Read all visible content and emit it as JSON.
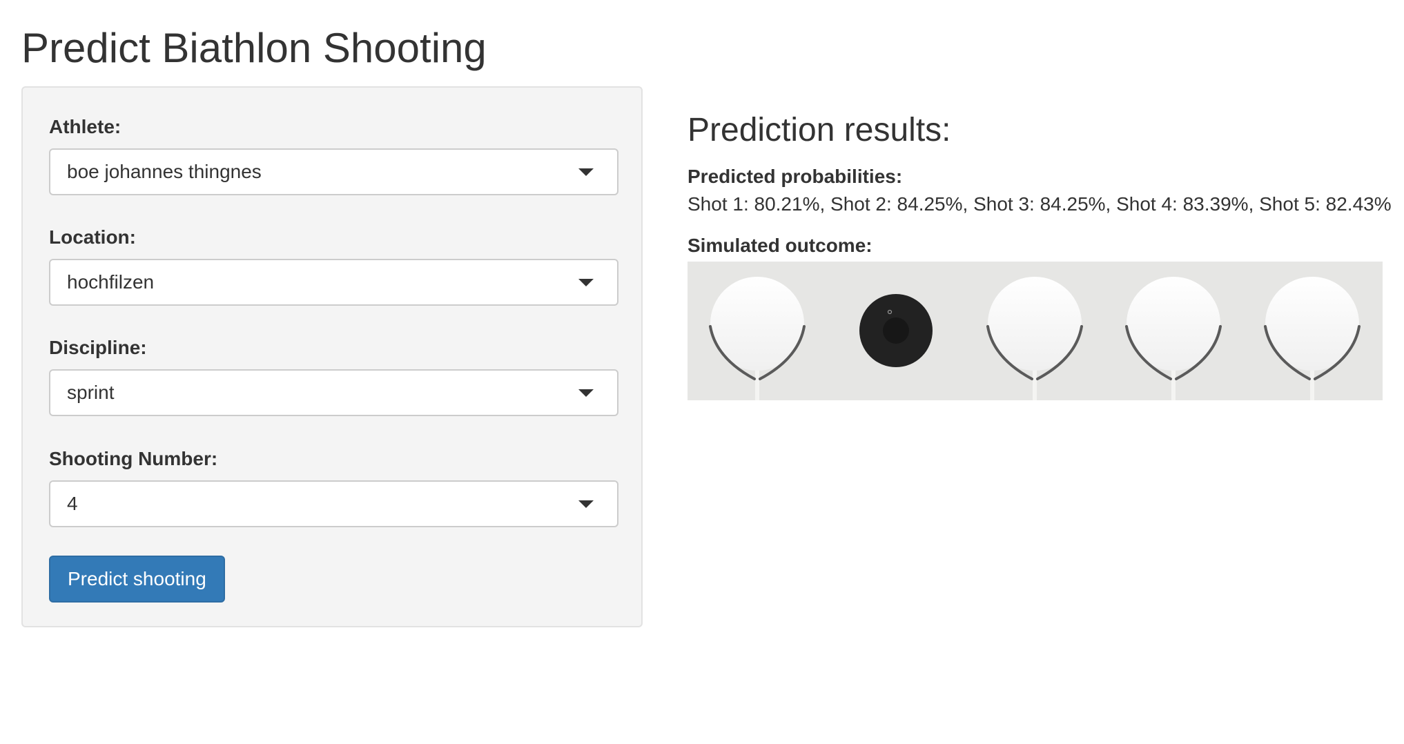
{
  "page": {
    "title": "Predict Biathlon Shooting"
  },
  "form": {
    "athlete": {
      "label": "Athlete:",
      "value": "boe johannes thingnes"
    },
    "location": {
      "label": "Location:",
      "value": "hochfilzen"
    },
    "discipline": {
      "label": "Discipline:",
      "value": "sprint"
    },
    "shooting_number": {
      "label": "Shooting Number:",
      "value": "4"
    },
    "submit_label": "Predict shooting"
  },
  "results": {
    "title": "Prediction results:",
    "probabilities_label": "Predicted probabilities:",
    "probabilities_text": "Shot 1: 80.21%, Shot 2: 84.25%, Shot 3: 84.25%, Shot 4: 83.39%, Shot 5: 82.43%",
    "outcome_label": "Simulated outcome:",
    "outcome": [
      {
        "shot": 1,
        "result": "hit",
        "icon": "target-hit-icon"
      },
      {
        "shot": 2,
        "result": "miss",
        "icon": "target-miss-icon"
      },
      {
        "shot": 3,
        "result": "hit",
        "icon": "target-hit-icon"
      },
      {
        "shot": 4,
        "result": "hit",
        "icon": "target-hit-icon"
      },
      {
        "shot": 5,
        "result": "hit",
        "icon": "target-hit-icon"
      }
    ]
  },
  "colors": {
    "primary_button": "#337ab7",
    "panel_background": "#f4f4f4",
    "outcome_background": "#e6e6e4",
    "miss_target": "#222222",
    "hit_target": "#ffffff"
  }
}
